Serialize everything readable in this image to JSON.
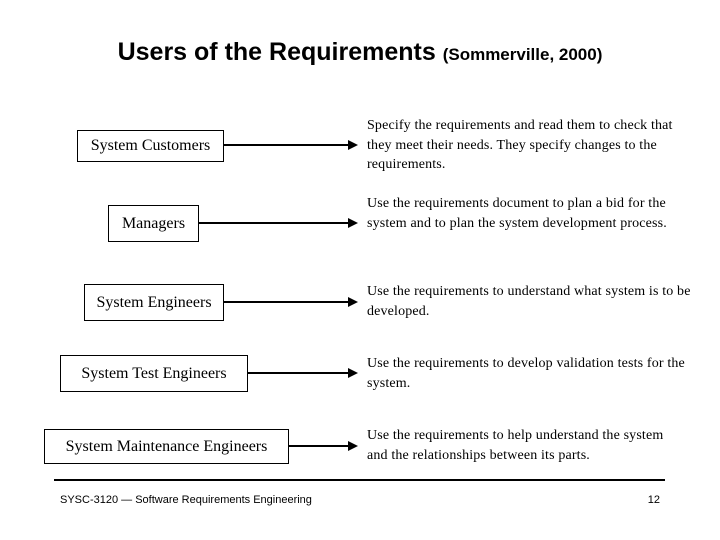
{
  "slide": {
    "title": "Users of the Requirements",
    "citation": "(Sommerville, 2000)",
    "users": [
      {
        "role": "System Customers",
        "description": "Specify the requirements and read them to check that they meet their needs. They specify changes to the requirements."
      },
      {
        "role": "Managers",
        "description": "Use the requirements document to plan a bid for the system and to plan the system development process."
      },
      {
        "role": "System Engineers",
        "description": "Use the requirements to understand what system is to be developed."
      },
      {
        "role": "System Test Engineers",
        "description": "Use the requirements to develop validation tests for the system."
      },
      {
        "role": "System Maintenance Engineers",
        "description": "Use the requirements to help understand the system and the relationships between its parts."
      }
    ],
    "footer": {
      "course": "SYSC-3120 — Software Requirements Engineering",
      "page_number": "12"
    }
  }
}
